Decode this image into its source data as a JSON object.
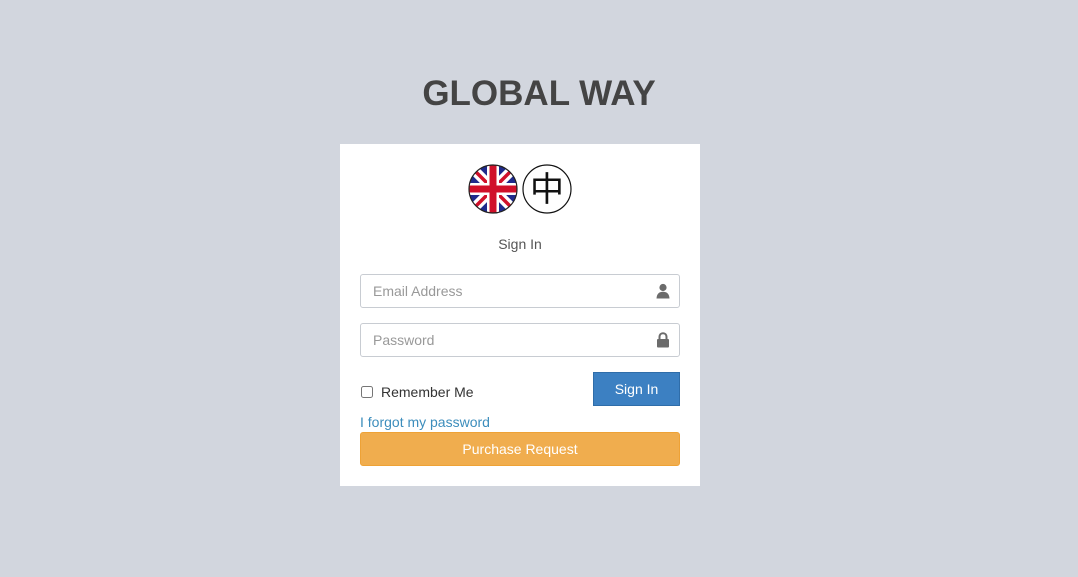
{
  "logo": {
    "text": "GLOBAL WAY"
  },
  "languages": [
    {
      "name": "english-flag-icon"
    },
    {
      "name": "chinese-flag-icon",
      "glyph": "中"
    }
  ],
  "login": {
    "message": "Sign In",
    "email_placeholder": "Email Address",
    "password_placeholder": "Password",
    "remember_label": "Remember Me",
    "signin_label": "Sign In",
    "forgot_label": "I forgot my password",
    "purchase_label": "Purchase Request"
  },
  "colors": {
    "background": "#d2d6de",
    "primary": "#3c80c2",
    "warning": "#f0ad4e",
    "link": "#3c8dbc"
  }
}
